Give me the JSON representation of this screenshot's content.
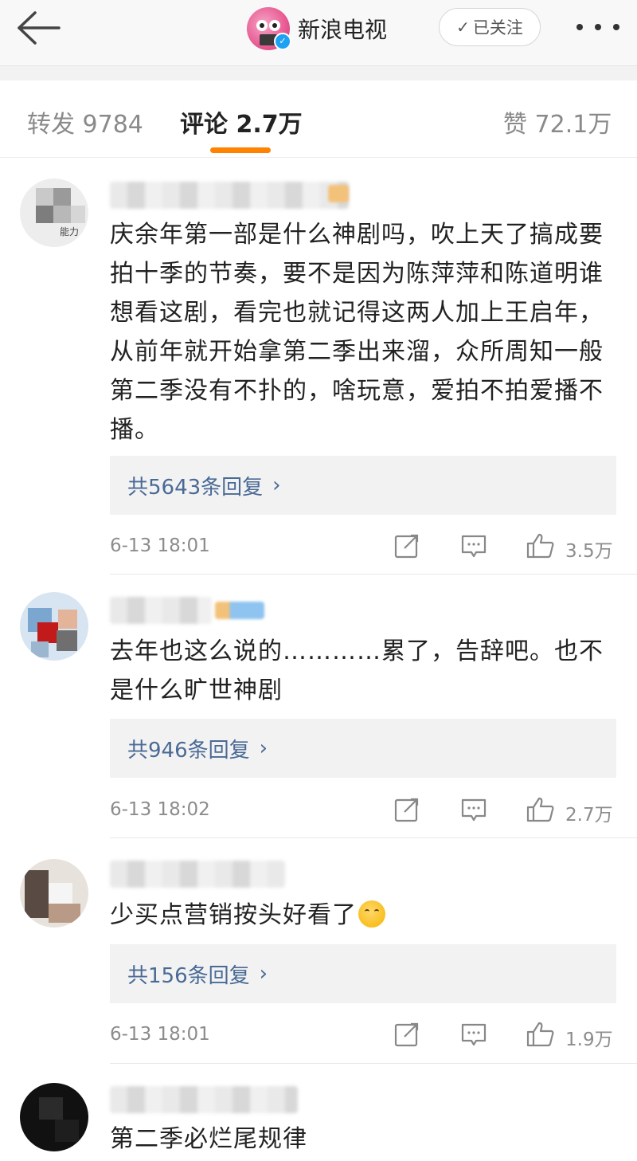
{
  "header": {
    "back_icon": "arrow-left-icon",
    "account_name": "新浪电视",
    "verified_icon": "verified-check-icon",
    "follow_label": "已关注",
    "follow_icon": "check-icon",
    "more_icon": "more-dots-icon"
  },
  "tabs": {
    "reposts": "转发 9784",
    "comments": "评论 2.7万",
    "likes": "赞 72.1万",
    "accent": "#ff8200"
  },
  "comments": [
    {
      "text": "庆余年第一部是什么神剧吗，吹上天了搞成要拍十季的节奏，要不是因为陈萍萍和陈道明谁想看这剧，看完也就记得这两人加上王启年，从前年就开始拿第二季出来溜，众所周知一般第二季没有不扑的，啥玩意，爱拍不拍爱播不播。",
      "avatar_text": "能力",
      "replies": "共5643条回复",
      "time": "6-13 18:01",
      "likes": "3.5万"
    },
    {
      "text": "去年也这么说的…………累了，告辞吧。也不是什么旷世神剧",
      "replies": "共946条回复",
      "time": "6-13 18:02",
      "likes": "2.7万"
    },
    {
      "text": "少买点营销按头好看了",
      "emoji_icon": "hugging-face-emoji",
      "replies": "共156条回复",
      "time": "6-13 18:01",
      "likes": "1.9万"
    },
    {
      "text": "第二季必烂尾规律"
    }
  ],
  "colors": {
    "link": "#4a6a96",
    "meta": "#8c8c8c",
    "reply_bg": "#f2f2f2"
  }
}
